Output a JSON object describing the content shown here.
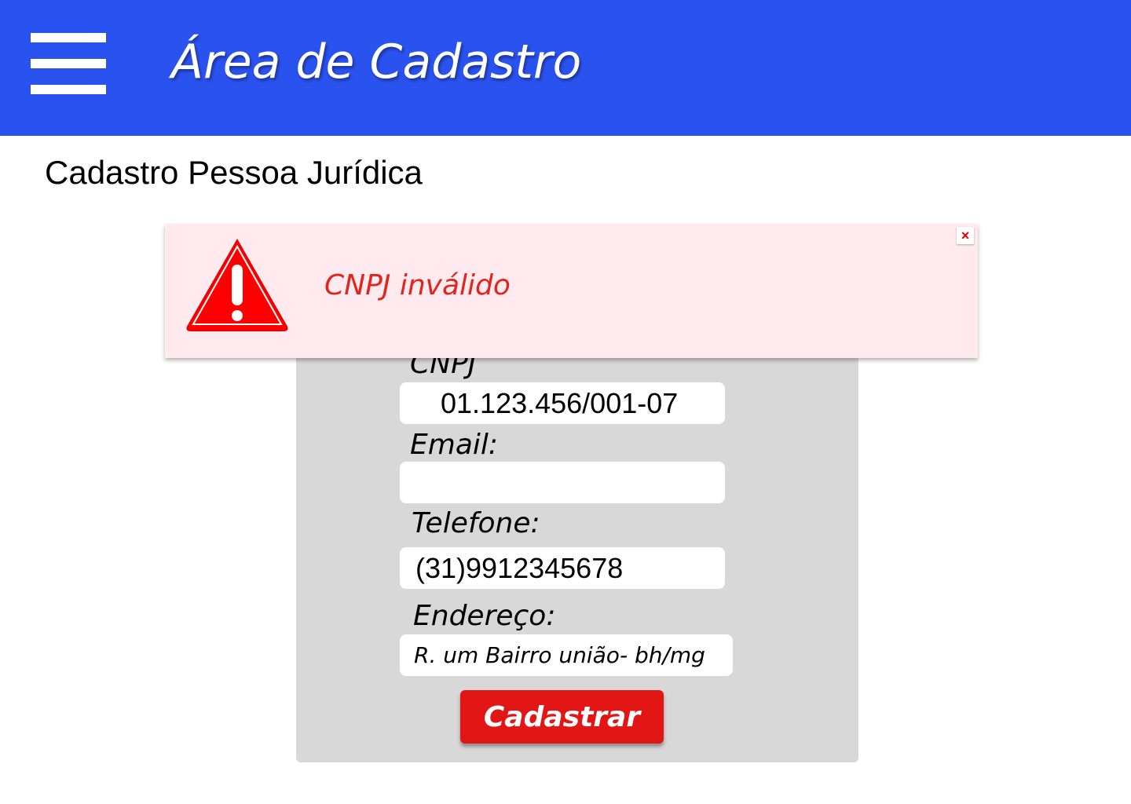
{
  "header": {
    "menu_icon": "hamburger-menu-icon",
    "title": "Área de Cadastro",
    "background_color": "#2a52ef"
  },
  "page": {
    "heading": "Cadastro Pessoa Jurídica"
  },
  "alert": {
    "icon": "warning-triangle-icon",
    "message": "CNPJ inválido",
    "close_label": "×",
    "background_color": "#ffeaf0",
    "text_color": "#e3241b"
  },
  "form": {
    "cnpj": {
      "label": "CNPJ",
      "value": "01.123.456/001-07"
    },
    "email": {
      "label": "Email:",
      "value": ""
    },
    "telefone": {
      "label": "Telefone:",
      "value": "(31)9912345678"
    },
    "endereco": {
      "label": "Endereço:",
      "value": "R. um Bairro união- bh/mg"
    },
    "submit_label": "Cadastrar",
    "submit_color": "#e31616"
  }
}
